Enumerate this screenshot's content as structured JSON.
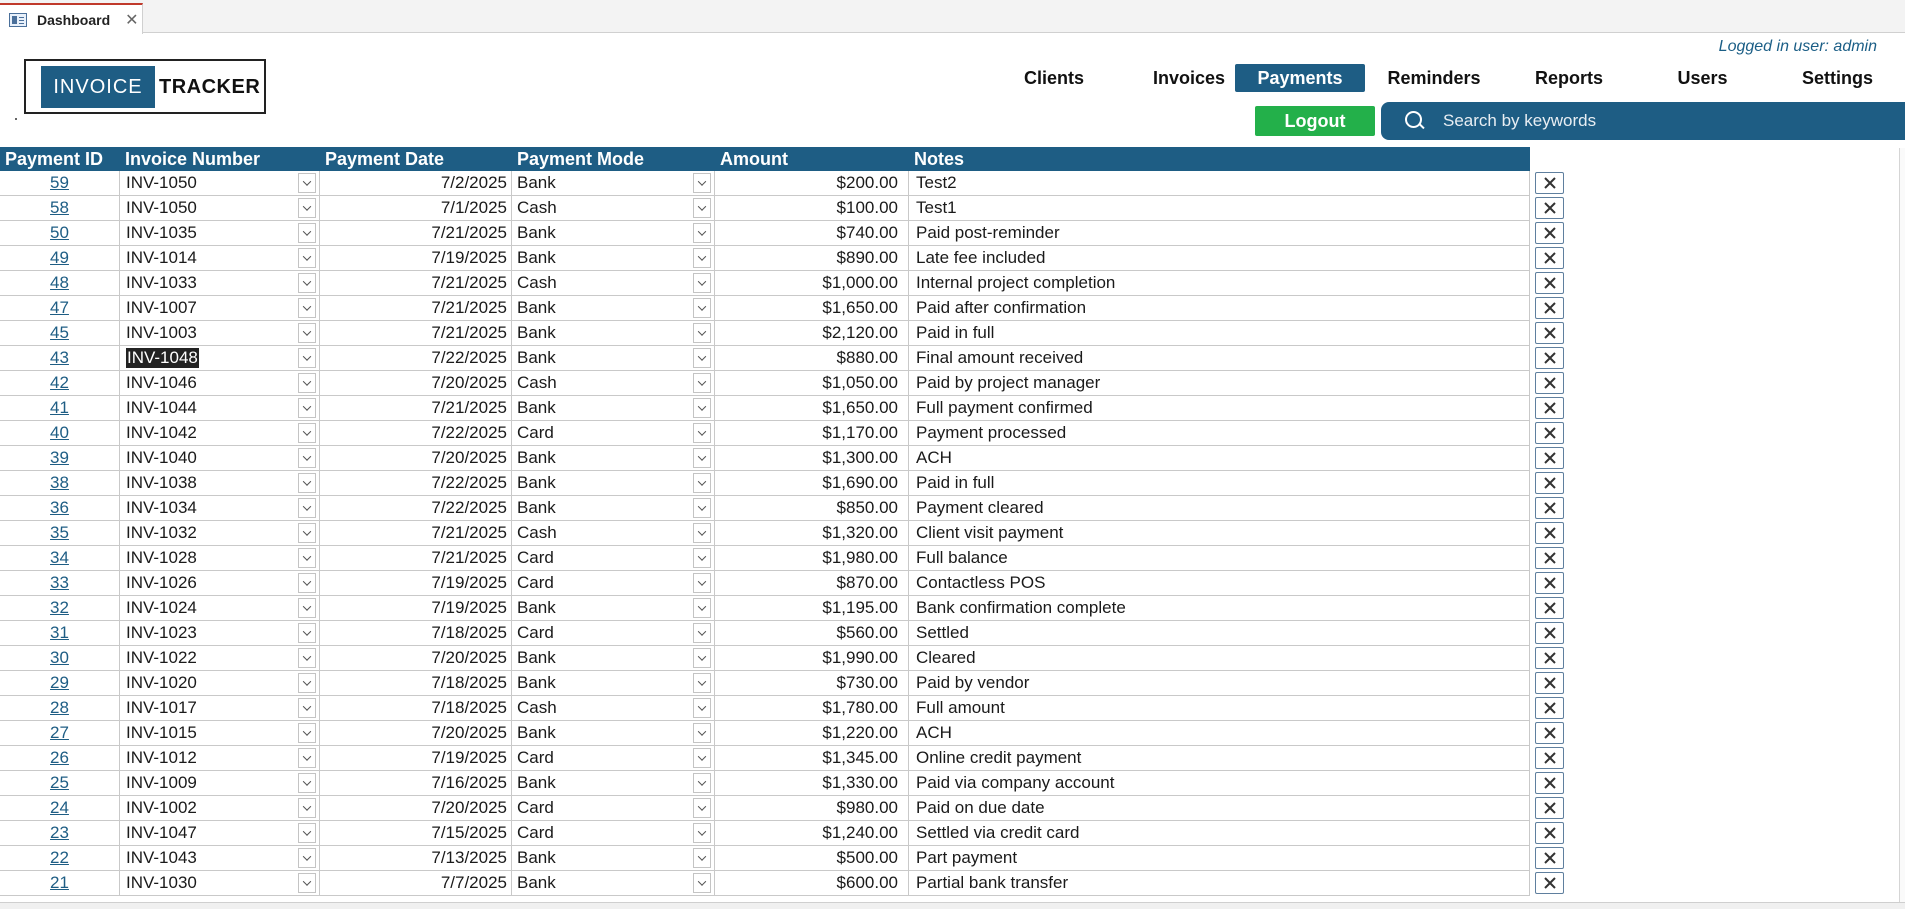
{
  "tab": {
    "label": "Dashboard",
    "close": "✕"
  },
  "header": {
    "logged_user": "Logged in user: admin",
    "logo_left": "INVOICE",
    "logo_right": "TRACKER"
  },
  "nav": [
    {
      "label": "Clients",
      "active": false
    },
    {
      "label": "Invoices",
      "active": false
    },
    {
      "label": "Payments",
      "active": true
    },
    {
      "label": "Reminders",
      "active": false
    },
    {
      "label": "Reports",
      "active": false
    },
    {
      "label": "Users",
      "active": false
    },
    {
      "label": "Settings",
      "active": false
    }
  ],
  "logout_label": "Logout",
  "search": {
    "placeholder": "Search by keywords",
    "value": ""
  },
  "table": {
    "columns": [
      "Payment ID",
      "Invoice Number",
      "Payment Date",
      "Payment Mode",
      "Amount",
      "Notes"
    ],
    "selected_row_id": "43",
    "rows": [
      {
        "id": "59",
        "invoice": "INV-1050",
        "date": "7/2/2025",
        "mode": "Bank",
        "amount": "$200.00",
        "notes": "Test2"
      },
      {
        "id": "58",
        "invoice": "INV-1050",
        "date": "7/1/2025",
        "mode": "Cash",
        "amount": "$100.00",
        "notes": "Test1"
      },
      {
        "id": "50",
        "invoice": "INV-1035",
        "date": "7/21/2025",
        "mode": "Bank",
        "amount": "$740.00",
        "notes": "Paid post-reminder"
      },
      {
        "id": "49",
        "invoice": "INV-1014",
        "date": "7/19/2025",
        "mode": "Bank",
        "amount": "$890.00",
        "notes": "Late fee included"
      },
      {
        "id": "48",
        "invoice": "INV-1033",
        "date": "7/21/2025",
        "mode": "Cash",
        "amount": "$1,000.00",
        "notes": "Internal project completion"
      },
      {
        "id": "47",
        "invoice": "INV-1007",
        "date": "7/21/2025",
        "mode": "Bank",
        "amount": "$1,650.00",
        "notes": "Paid after confirmation"
      },
      {
        "id": "45",
        "invoice": "INV-1003",
        "date": "7/21/2025",
        "mode": "Bank",
        "amount": "$2,120.00",
        "notes": "Paid in full"
      },
      {
        "id": "43",
        "invoice": "INV-1048",
        "date": "7/22/2025",
        "mode": "Bank",
        "amount": "$880.00",
        "notes": "Final amount received"
      },
      {
        "id": "42",
        "invoice": "INV-1046",
        "date": "7/20/2025",
        "mode": "Cash",
        "amount": "$1,050.00",
        "notes": "Paid by project manager"
      },
      {
        "id": "41",
        "invoice": "INV-1044",
        "date": "7/21/2025",
        "mode": "Bank",
        "amount": "$1,650.00",
        "notes": "Full payment confirmed"
      },
      {
        "id": "40",
        "invoice": "INV-1042",
        "date": "7/22/2025",
        "mode": "Card",
        "amount": "$1,170.00",
        "notes": "Payment processed"
      },
      {
        "id": "39",
        "invoice": "INV-1040",
        "date": "7/20/2025",
        "mode": "Bank",
        "amount": "$1,300.00",
        "notes": "ACH"
      },
      {
        "id": "38",
        "invoice": "INV-1038",
        "date": "7/22/2025",
        "mode": "Bank",
        "amount": "$1,690.00",
        "notes": "Paid in full"
      },
      {
        "id": "36",
        "invoice": "INV-1034",
        "date": "7/22/2025",
        "mode": "Bank",
        "amount": "$850.00",
        "notes": "Payment cleared"
      },
      {
        "id": "35",
        "invoice": "INV-1032",
        "date": "7/21/2025",
        "mode": "Cash",
        "amount": "$1,320.00",
        "notes": "Client visit payment"
      },
      {
        "id": "34",
        "invoice": "INV-1028",
        "date": "7/21/2025",
        "mode": "Card",
        "amount": "$1,980.00",
        "notes": "Full balance"
      },
      {
        "id": "33",
        "invoice": "INV-1026",
        "date": "7/19/2025",
        "mode": "Card",
        "amount": "$870.00",
        "notes": "Contactless POS"
      },
      {
        "id": "32",
        "invoice": "INV-1024",
        "date": "7/19/2025",
        "mode": "Bank",
        "amount": "$1,195.00",
        "notes": "Bank confirmation complete"
      },
      {
        "id": "31",
        "invoice": "INV-1023",
        "date": "7/18/2025",
        "mode": "Card",
        "amount": "$560.00",
        "notes": "Settled"
      },
      {
        "id": "30",
        "invoice": "INV-1022",
        "date": "7/20/2025",
        "mode": "Bank",
        "amount": "$1,990.00",
        "notes": "Cleared"
      },
      {
        "id": "29",
        "invoice": "INV-1020",
        "date": "7/18/2025",
        "mode": "Bank",
        "amount": "$730.00",
        "notes": "Paid by vendor"
      },
      {
        "id": "28",
        "invoice": "INV-1017",
        "date": "7/18/2025",
        "mode": "Cash",
        "amount": "$1,780.00",
        "notes": "Full amount"
      },
      {
        "id": "27",
        "invoice": "INV-1015",
        "date": "7/20/2025",
        "mode": "Bank",
        "amount": "$1,220.00",
        "notes": "ACH"
      },
      {
        "id": "26",
        "invoice": "INV-1012",
        "date": "7/19/2025",
        "mode": "Card",
        "amount": "$1,345.00",
        "notes": "Online credit payment"
      },
      {
        "id": "25",
        "invoice": "INV-1009",
        "date": "7/16/2025",
        "mode": "Bank",
        "amount": "$1,330.00",
        "notes": "Paid via company account"
      },
      {
        "id": "24",
        "invoice": "INV-1002",
        "date": "7/20/2025",
        "mode": "Card",
        "amount": "$980.00",
        "notes": "Paid on due date"
      },
      {
        "id": "23",
        "invoice": "INV-1047",
        "date": "7/15/2025",
        "mode": "Card",
        "amount": "$1,240.00",
        "notes": "Settled via credit card"
      },
      {
        "id": "22",
        "invoice": "INV-1043",
        "date": "7/13/2025",
        "mode": "Bank",
        "amount": "$500.00",
        "notes": "Part payment"
      },
      {
        "id": "21",
        "invoice": "INV-1030",
        "date": "7/7/2025",
        "mode": "Bank",
        "amount": "$600.00",
        "notes": "Partial bank transfer"
      }
    ]
  },
  "colors": {
    "brand": "#1e5d84",
    "logout": "#23b04a",
    "tab_accent": "#c0392b"
  }
}
